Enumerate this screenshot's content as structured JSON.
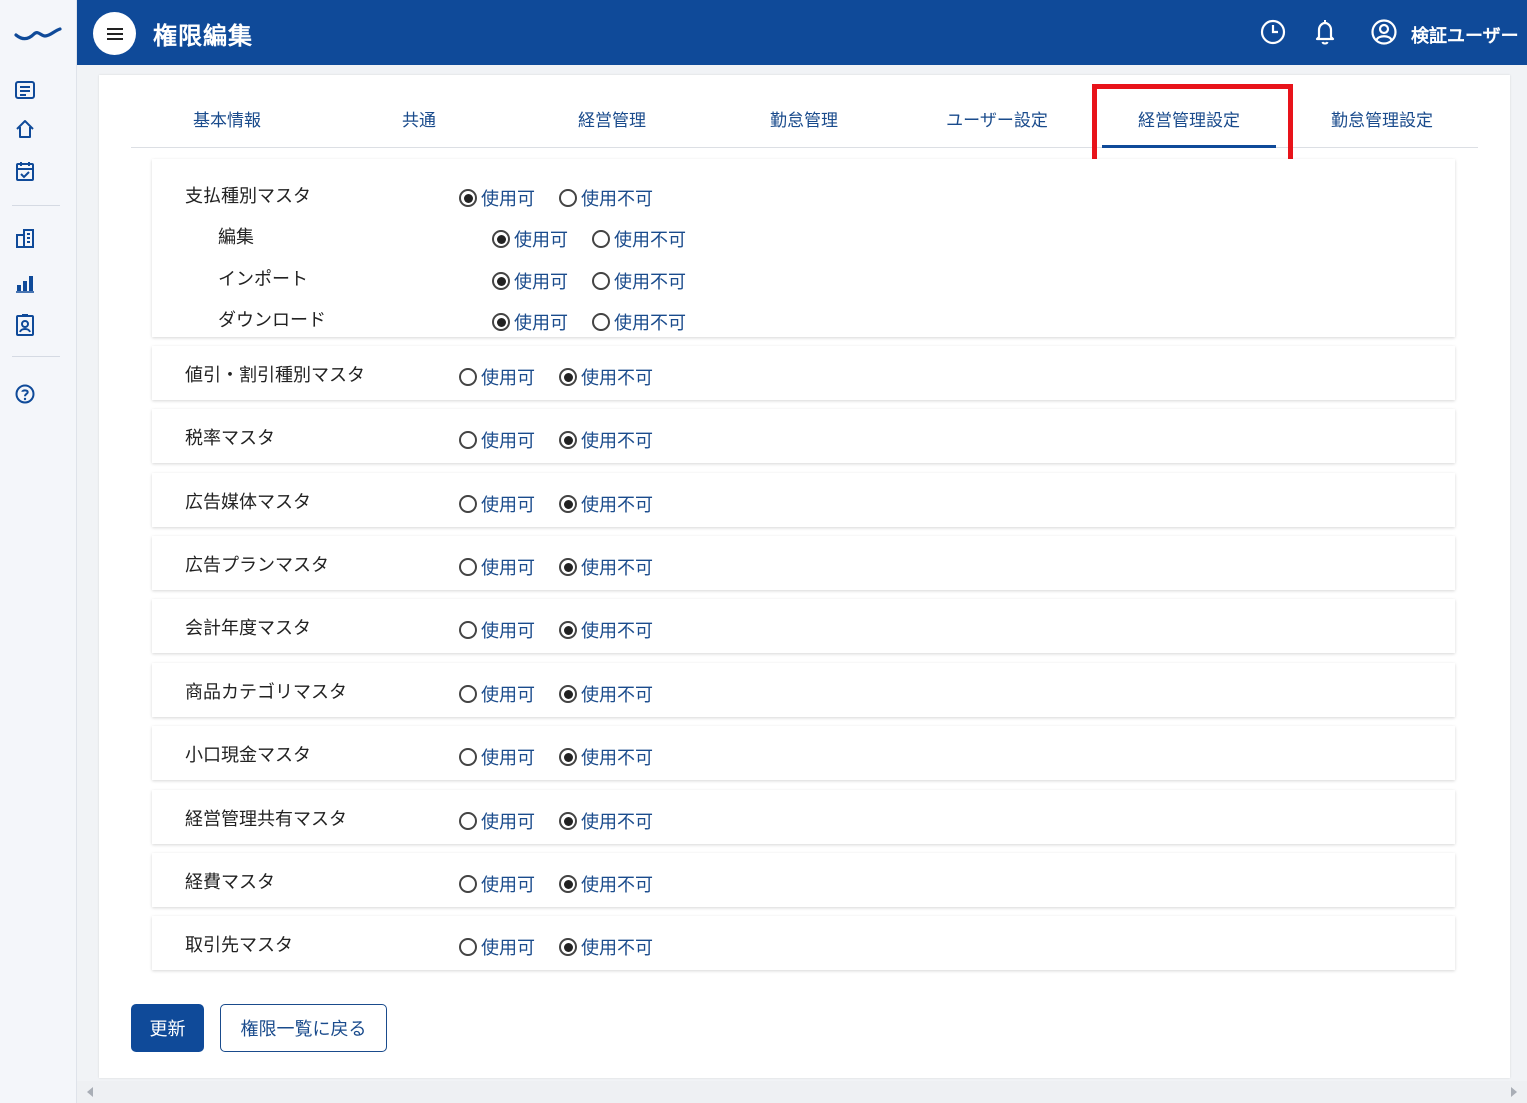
{
  "header": {
    "title": "権限編集",
    "user_name": "検証ユーザー"
  },
  "tabs": [
    {
      "label": "基本情報",
      "active": false
    },
    {
      "label": "共通",
      "active": false
    },
    {
      "label": "経営管理",
      "active": false
    },
    {
      "label": "勤怠管理",
      "active": false
    },
    {
      "label": "ユーザー設定",
      "active": false
    },
    {
      "label": "経営管理設定",
      "active": true
    },
    {
      "label": "勤怠管理設定",
      "active": false
    }
  ],
  "options": {
    "allowed": "使用可",
    "denied": "使用不可"
  },
  "permissions": [
    {
      "label": "支払種別マスタ",
      "value": "使用可",
      "children": [
        {
          "label": "編集",
          "value": "使用可"
        },
        {
          "label": "インポート",
          "value": "使用可"
        },
        {
          "label": "ダウンロード",
          "value": "使用可"
        }
      ]
    },
    {
      "label": "値引・割引種別マスタ",
      "value": "使用不可"
    },
    {
      "label": "税率マスタ",
      "value": "使用不可"
    },
    {
      "label": "広告媒体マスタ",
      "value": "使用不可"
    },
    {
      "label": "広告プランマスタ",
      "value": "使用不可"
    },
    {
      "label": "会計年度マスタ",
      "value": "使用不可"
    },
    {
      "label": "商品カテゴリマスタ",
      "value": "使用不可"
    },
    {
      "label": "小口現金マスタ",
      "value": "使用不可"
    },
    {
      "label": "経営管理共有マスタ",
      "value": "使用不可"
    },
    {
      "label": "経費マスタ",
      "value": "使用不可"
    },
    {
      "label": "取引先マスタ",
      "value": "使用不可"
    }
  ],
  "buttons": {
    "update": "更新",
    "back": "権限一覧に戻る"
  },
  "colors": {
    "primary": "#0f4a99",
    "highlight": "#e8131a"
  },
  "icons": {
    "sidebar": [
      "list-icon",
      "home-icon",
      "calendar-check-icon",
      "building-icon",
      "bar-chart-icon",
      "id-badge-icon",
      "help-icon"
    ],
    "header": [
      "menu-icon",
      "history-icon",
      "bell-icon",
      "user-circle-icon"
    ]
  }
}
